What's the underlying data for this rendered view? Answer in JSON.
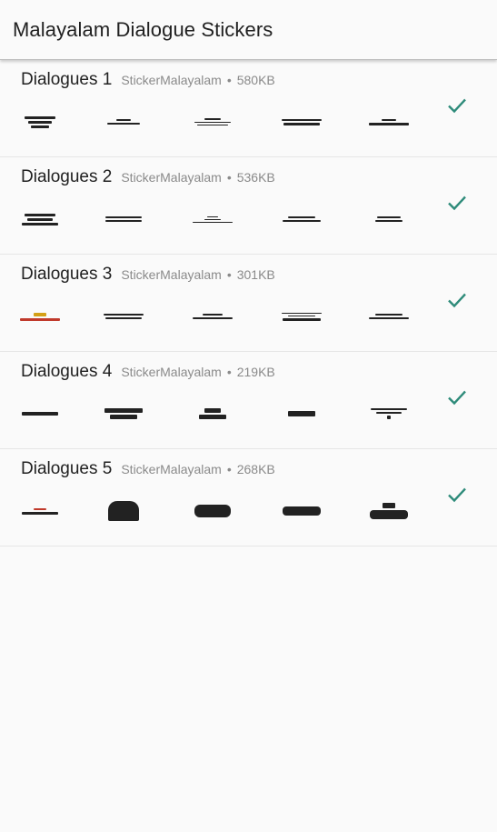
{
  "appbar": {
    "title": "Malayalam Dialogue Stickers"
  },
  "colors": {
    "accent": "#2e8b7a",
    "meta": "#8a8a8a",
    "divider": "#e6e6e6"
  },
  "packs": [
    {
      "name": "Dialogues 1",
      "publisher": "StickerMalayalam",
      "separator": "•",
      "size": "580KB",
      "status_icon": "check-icon"
    },
    {
      "name": "Dialogues 2",
      "publisher": "StickerMalayalam",
      "separator": "•",
      "size": "536KB",
      "status_icon": "check-icon"
    },
    {
      "name": "Dialogues 3",
      "publisher": "StickerMalayalam",
      "separator": "•",
      "size": "301KB",
      "status_icon": "check-icon"
    },
    {
      "name": "Dialogues 4",
      "publisher": "StickerMalayalam",
      "separator": "•",
      "size": "219KB",
      "status_icon": "check-icon"
    },
    {
      "name": "Dialogues 5",
      "publisher": "StickerMalayalam",
      "separator": "•",
      "size": "268KB",
      "status_icon": "check-icon"
    }
  ]
}
